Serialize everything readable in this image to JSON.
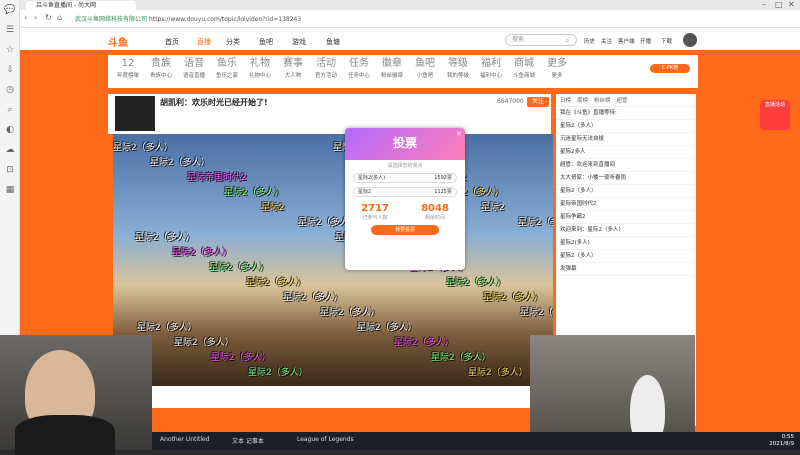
{
  "browser": {
    "tab_title": "吕斗鱼直播间 - 尚大网",
    "url_domain": "武汉斗鱼网络科技有限公司",
    "url": "https://www.douyu.com/topic/lolvideo?rid=138243",
    "sidebar_icons": [
      "chat-icon",
      "menu-icon",
      "star-icon",
      "download-icon",
      "history-icon",
      "search-icon",
      "game-icon",
      "cloud-icon",
      "cart-icon",
      "apps-icon"
    ]
  },
  "site": {
    "logo": "斗鱼",
    "nav": [
      "首页",
      "直播",
      "分类",
      "鱼吧",
      "游戏",
      "鱼塘"
    ],
    "search_placeholder": "搜索",
    "header_right": [
      "历史",
      "关注",
      "客户端",
      "开播",
      "下载"
    ]
  },
  "categories": [
    {
      "label": "12",
      "sub": "年度榜单"
    },
    {
      "label": "贵族",
      "sub": "贵族中心"
    },
    {
      "label": "语音",
      "sub": "语音直播"
    },
    {
      "label": "鱼乐",
      "sub": "鱼乐之家"
    },
    {
      "label": "礼物",
      "sub": "礼物中心"
    },
    {
      "label": "赛事",
      "sub": "大人物"
    },
    {
      "label": "活动",
      "sub": "官方活动"
    },
    {
      "label": "任务",
      "sub": "任务中心"
    },
    {
      "label": "徽章",
      "sub": "粉丝徽章"
    },
    {
      "label": "鱼吧",
      "sub": "小鱼吧"
    },
    {
      "label": "等级",
      "sub": "我的等级"
    },
    {
      "label": "福利",
      "sub": "福利中心"
    },
    {
      "label": "商城",
      "sub": "斗鱼商城"
    },
    {
      "label": "更多",
      "sub": "更多"
    }
  ],
  "room": {
    "title": "胡凯利：欢乐时光已经开始了!",
    "follow_label": "关注",
    "followers": "6647000"
  },
  "danmaku": [
    "星际2（多人）",
    "星际2（多人）",
    "星际帝国时代2",
    "星际2（多人）",
    "星际2",
    "星际2（多人）行李2",
    "星际2（多人）",
    "星际2（多人）",
    "星际2（多人）",
    "星际2（多人）",
    "星际2（多人）",
    "星际2（多人）",
    "星际2（多人）",
    "星际2（多人）",
    "星际2（多人）",
    "星际2（多人）"
  ],
  "vote": {
    "title": "投票",
    "subtitle": "请选择您的观点",
    "options": [
      {
        "label": "星际2(多人)",
        "count": "1592票"
      },
      {
        "label": "星际2",
        "count": "1125票"
      }
    ],
    "total_votes": "2717",
    "total_label": "已参与人数",
    "remain": "8048",
    "remain_label": "剩余时间",
    "vote_button": "我要投票"
  },
  "chat": {
    "tabs": [
      "日榜",
      "周榜",
      "粉丝榜",
      "超管"
    ],
    "lines": [
      "我在《斗鱼》直播等待:",
      "  星际2（多人）",
      "  沉迷星际无法自拔",
      "  星际2多人",
      "  超管：欢迎来到直播间",
      "大大哥家：小楼一夜听春雨",
      "星际2（多人）",
      "星际帝国时代2",
      "星际争霸2",
      "欢迎来到：星际2（多人）",
      "星际2(多人)",
      "星际2（多人）",
      "发弹幕"
    ]
  },
  "taskbar": {
    "items": [
      "Another Untitled",
      "文本 记事本",
      "League of Legends"
    ],
    "time": "0:55",
    "date": "2021/8/9"
  },
  "promo": {
    "label": "直播活动"
  }
}
